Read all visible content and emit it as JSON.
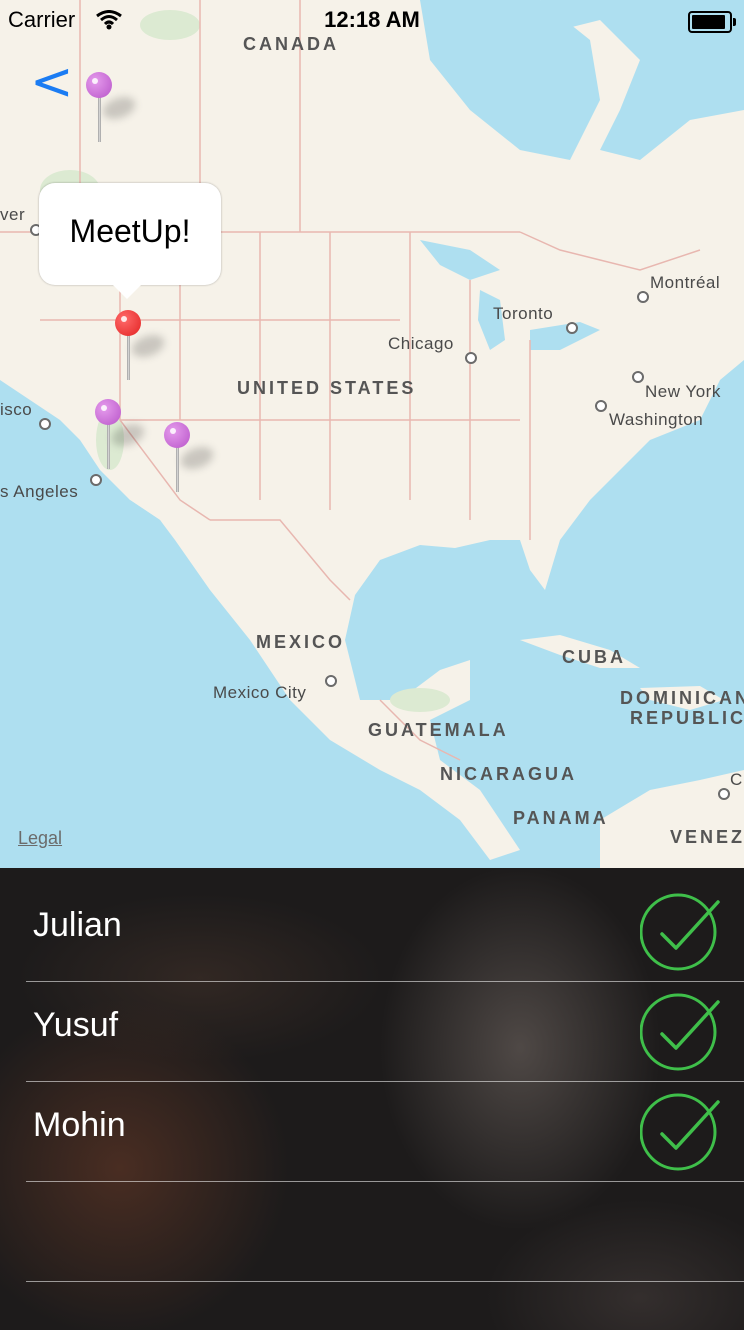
{
  "status_bar": {
    "carrier": "Carrier",
    "time": "12:18 AM"
  },
  "nav": {
    "back_label": "<"
  },
  "map": {
    "labels": {
      "canada": "CANADA",
      "united_states": "UNITED STATES",
      "mexico": "MEXICO",
      "cuba": "CUBA",
      "dominican": "DOMINICAN",
      "republic": "REPUBLIC",
      "guatemala": "GUATEMALA",
      "nicaragua": "NICARAGUA",
      "panama": "PANAMA",
      "venez": "VENEZ",
      "chicago": "Chicago",
      "toronto": "Toronto",
      "montreal": "Montréal",
      "new_york": "New York",
      "washington": "Washington",
      "mexico_city": "Mexico City",
      "san_francisco_partial": "isco",
      "los_angeles_partial": "s Angeles",
      "vancouver_partial": "ver",
      "colombia_partial": "C"
    },
    "callout": "MeetUp!",
    "legal": "Legal",
    "colors": {
      "water": "#aedff0",
      "land": "#f6f2e9",
      "pin_purple": "#c86ad8",
      "pin_red": "#e83030"
    }
  },
  "people": [
    {
      "name": "Julian",
      "status": "check-icon"
    },
    {
      "name": "Yusuf",
      "status": "check-icon"
    },
    {
      "name": "Mohin",
      "status": "check-icon"
    }
  ],
  "accent": {
    "check_green": "#3fbf4a",
    "back_blue": "#1b7cf3"
  }
}
